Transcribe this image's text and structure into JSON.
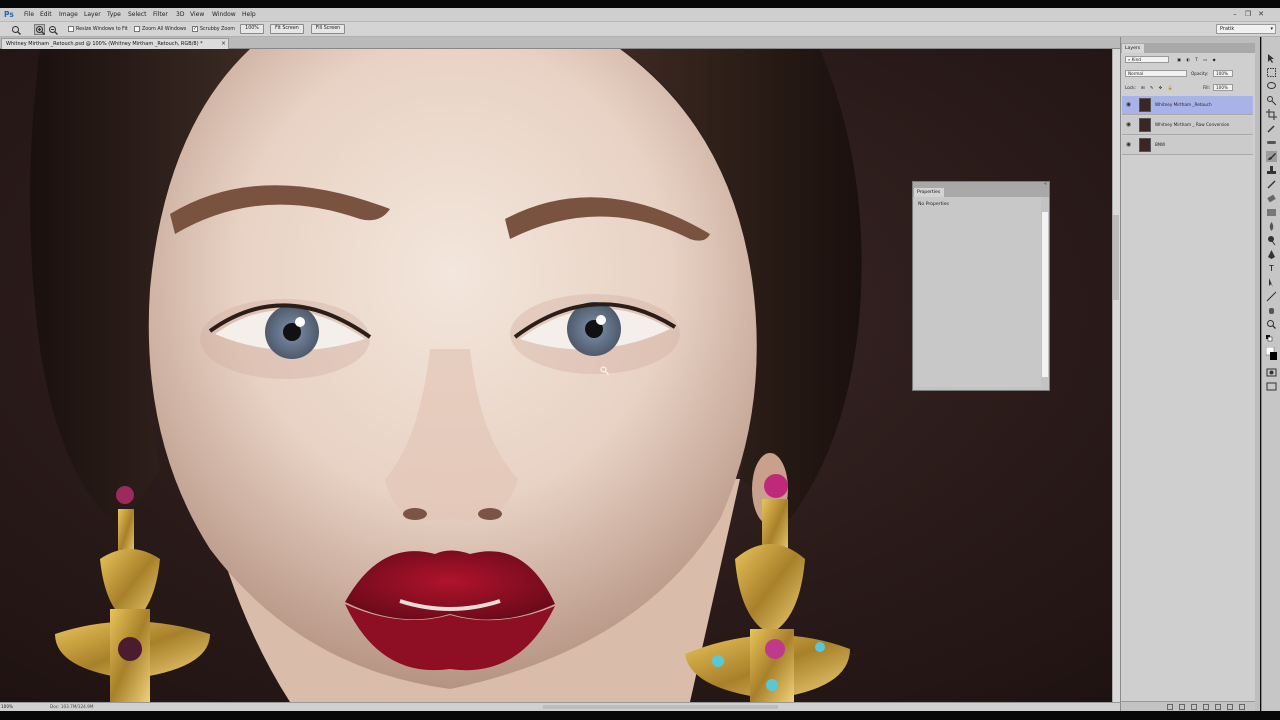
{
  "app": {
    "logo": "Ps"
  },
  "menu": [
    "File",
    "Edit",
    "Image",
    "Layer",
    "Type",
    "Select",
    "Filter",
    "3D",
    "View",
    "Window",
    "Help"
  ],
  "workspace": "Pratik",
  "options": {
    "resize_windows": "Resize Windows to Fit",
    "zoom_all": "Zoom All Windows",
    "scrubby_zoom": "Scrubby Zoom",
    "btn_100": "100%",
    "btn_fit": "Fit Screen",
    "btn_fill": "Fill Screen"
  },
  "document": {
    "tab_title": "Whitney Mirtham _Retouch.psd @ 100% (Whitney Mirtham _Retouch, RGB/8) *",
    "close": "×"
  },
  "status": {
    "zoom": "100%",
    "doc": "Doc: 103.7M/124.9M"
  },
  "layers_panel": {
    "title": "Layers",
    "kind": "Kind",
    "blend_mode": "Normal",
    "opacity_label": "Opacity:",
    "opacity_value": "100%",
    "lock_label": "Lock:",
    "fill_label": "Fill:",
    "fill_value": "100%",
    "layers": [
      {
        "name": "Whitney Mirtham _Retouch",
        "selected": true
      },
      {
        "name": "Whitney Mirtham _ Raw Conversion",
        "selected": false
      },
      {
        "name": "BNW",
        "selected": false
      }
    ]
  },
  "properties_panel": {
    "title": "Properties",
    "text": "No Properties"
  },
  "colors": {
    "accent_selected_layer": "#aab3e8",
    "chrome": "#cfcfcf",
    "logo": "#2b66b3"
  }
}
